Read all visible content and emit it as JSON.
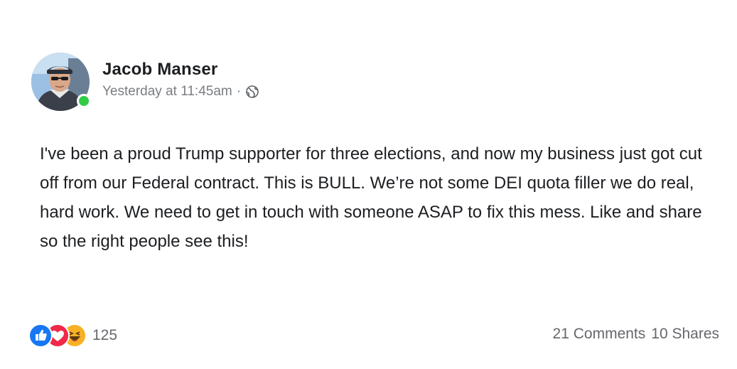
{
  "post": {
    "author": {
      "name": "Jacob Manser",
      "online": true
    },
    "timestamp": "Yesterday at 11:45am",
    "separator": "·",
    "privacy_icon": "globe-icon",
    "text": "I've been a proud Trump supporter for three elections, and now my business just got cut off from our Federal contract. This is BULL. We’re not some DEI quota filler we do real, hard work. We need to get in touch with someone ASAP to fix this mess. Like and share so the right people see this!",
    "reactions": {
      "types": [
        "like-icon",
        "love-icon",
        "haha-icon"
      ],
      "count": "125"
    },
    "comments_label": "21 Comments",
    "shares_label": "10 Shares"
  },
  "colors": {
    "like": "#1877f2",
    "love": "#f0284a",
    "haha": "#f7b125",
    "online": "#31cc46",
    "meta_text": "#7a7d82"
  }
}
